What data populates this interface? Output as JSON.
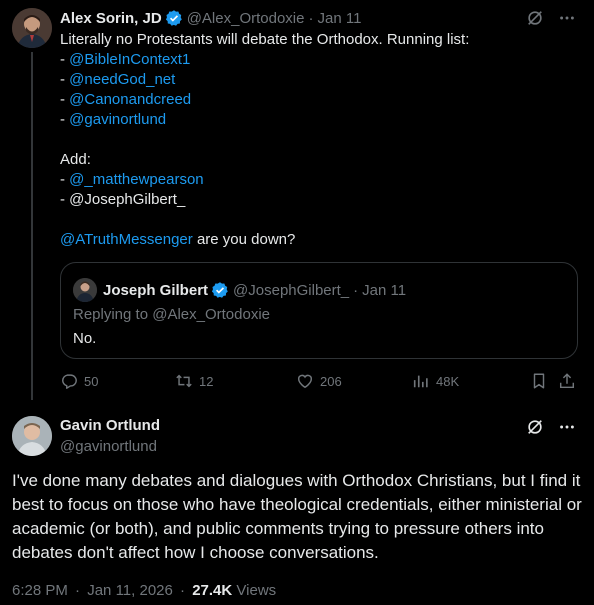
{
  "tweet1": {
    "author_name": "Alex Sorin, JD",
    "author_handle": "@Alex_Ortodoxie",
    "separator": "·",
    "timestamp": "Jan 11",
    "lines": [
      {
        "text": "Literally no Protestants will debate the Orthodox.  Running list:"
      },
      {
        "prefix": "- ",
        "link": "@BibleInContext1"
      },
      {
        "prefix": "- ",
        "link": "@needGod_net"
      },
      {
        "prefix": "- ",
        "link": "@Canonandcreed"
      },
      {
        "prefix": "- ",
        "link": "@gavinortlund"
      },
      {
        "text": ""
      },
      {
        "text": "Add:"
      },
      {
        "prefix": "- ",
        "link": "@_matthewpearson"
      },
      {
        "text": "- @JosephGilbert_"
      },
      {
        "text": ""
      },
      {
        "link": "@ATruthMessenger",
        "suffix": " are you down?"
      }
    ],
    "quote": {
      "author_name": "Joseph Gilbert",
      "author_handle": "@JosephGilbert_",
      "separator": "·",
      "timestamp": "Jan 11",
      "replying_to": "Replying to @Alex_Ortodoxie",
      "text": "No."
    },
    "actions": {
      "replies": "50",
      "reposts": "12",
      "likes": "206",
      "views": "48K"
    }
  },
  "tweet2": {
    "author_name": "Gavin Ortlund",
    "author_handle": "@gavinortlund",
    "text": "I've done many debates and dialogues with Orthodox Christians, but I find it best to focus on those who have theological credentials, either ministerial or academic (or both), and public comments trying to pressure others into debates don't affect how I choose conversations.",
    "time": "6:28 PM",
    "separator": "·",
    "date": "Jan 11, 2026",
    "views_count": "27.4K",
    "views_label": "Views"
  },
  "colors": {
    "background": "#000000",
    "text": "#e7e9ea",
    "muted": "#71767b",
    "link": "#1d9bf0",
    "border": "#2f3336"
  },
  "icons": [
    "verified-badge-icon",
    "grok-icon",
    "more-icon",
    "reply-icon",
    "repost-icon",
    "like-icon",
    "views-icon",
    "bookmark-icon",
    "share-icon"
  ]
}
